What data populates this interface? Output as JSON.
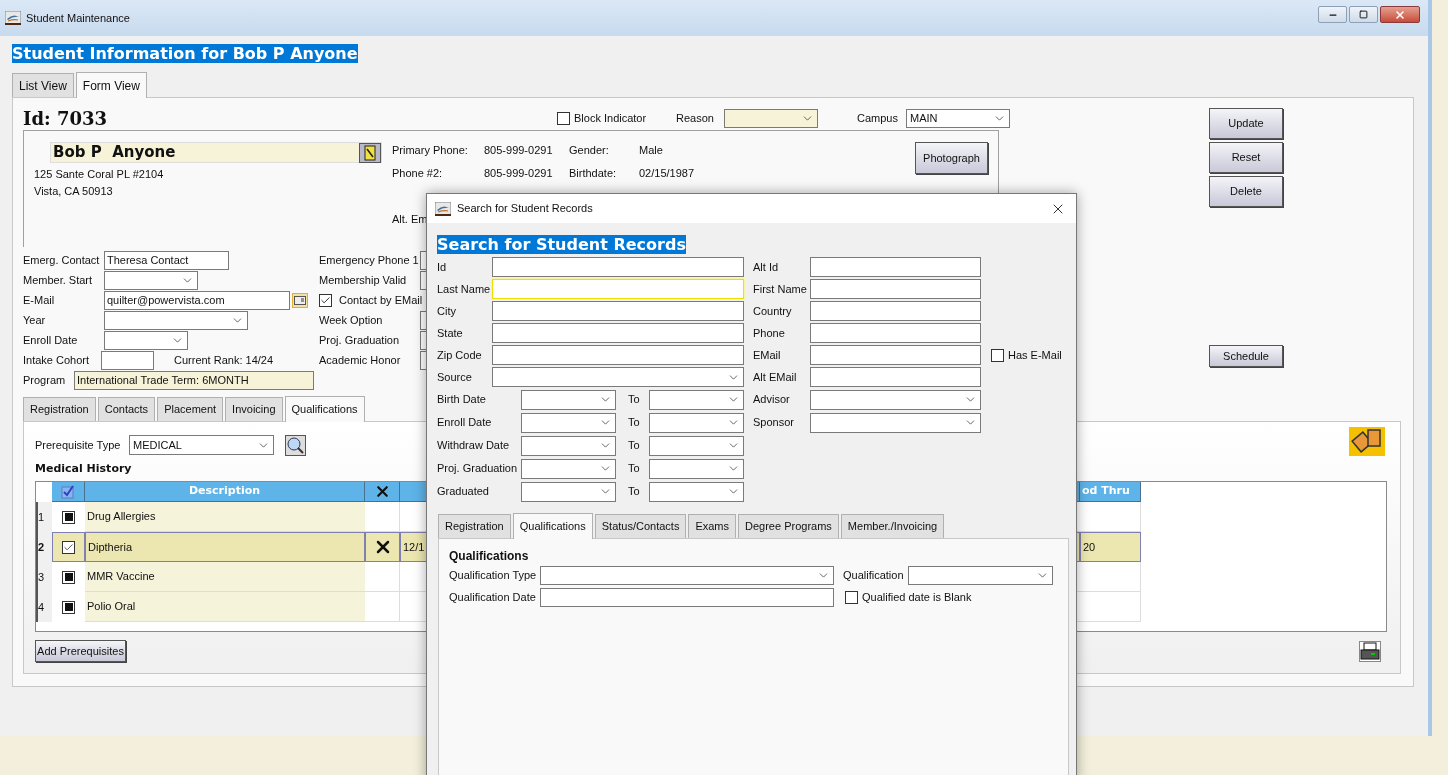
{
  "main_window": {
    "title": "Student Maintenance",
    "heading": "Student Information for Bob P Anyone",
    "view_tabs": [
      {
        "label": "List View",
        "selected": false
      },
      {
        "label": "Form View",
        "selected": true
      }
    ],
    "id_label": "Id: 7033",
    "block_indicator": {
      "label": "Block Indicator",
      "checked": false
    },
    "reason": {
      "label": "Reason"
    },
    "campus": {
      "label": "Campus",
      "value": "MAIN"
    },
    "student_card": {
      "name": "Bob P  Anyone",
      "address_lines": [
        "125 Sante Coral PL #2104",
        "Vista, CA 50913"
      ],
      "contact_rows": [
        {
          "label": "Primary Phone:",
          "value": "805-999-0291"
        },
        {
          "label": "Phone #2:",
          "value": "805-999-0291"
        },
        {},
        {
          "label": "Alt. Em"
        }
      ],
      "personal_rows": [
        {
          "label": "Gender:",
          "value": "Male"
        },
        {
          "label": "Birthdate:",
          "value": "02/15/1987"
        }
      ],
      "buttons": [
        "Photograph"
      ]
    },
    "action_buttons": [
      "Update",
      "Reset",
      "Delete"
    ],
    "schedule_button": "Schedule",
    "left_fields": [
      {
        "kind": "text",
        "label": "Emerg. Contact",
        "value": "Theresa Contact"
      },
      {
        "kind": "dropdown",
        "label": "Member. Start"
      },
      {
        "kind": "email",
        "label": "E-Mail",
        "value": "quilter@powervista.com"
      },
      {
        "kind": "dropdown",
        "label": "Year"
      },
      {
        "kind": "dropdown",
        "label": "Enroll Date"
      },
      {
        "kind": "cohort",
        "label": "Intake Cohort",
        "note": "Current Rank: 14/24"
      },
      {
        "kind": "program",
        "label": "Program",
        "value": "International Trade Term: 6MONTH"
      }
    ],
    "right_fields": [
      {
        "kind": "text",
        "label": "Emergency Phone 1"
      },
      {
        "kind": "text",
        "label": "Membership Valid"
      },
      {
        "kind": "checkbox",
        "label": "Contact by EMail",
        "checked": true
      },
      {
        "kind": "text",
        "label": "Week Option"
      },
      {
        "kind": "text",
        "label": "Proj. Graduation"
      },
      {
        "kind": "text",
        "label": "Academic Honor"
      }
    ],
    "sub_tabs": [
      {
        "label": "Registration",
        "selected": false
      },
      {
        "label": "Contacts",
        "selected": false
      },
      {
        "label": "Placement",
        "selected": false
      },
      {
        "label": "Invoicing",
        "selected": false
      },
      {
        "label": "Qualifications",
        "selected": true
      }
    ],
    "prerequisite_type": {
      "label": "Prerequisite Type",
      "value": "MEDICAL"
    },
    "section_title": "Medical History",
    "table": {
      "columns": [
        {
          "kind": "check"
        },
        {
          "kind": "text",
          "label": "Description"
        },
        {
          "kind": "icon"
        },
        {
          "kind": "text"
        },
        {
          "kind": "text",
          "label": "od Thru"
        }
      ],
      "rows": [
        {
          "number": "1",
          "checked": false,
          "description": "Drug Allergies",
          "selected": false
        },
        {
          "number": "2",
          "checked": true,
          "description": "Diptheria",
          "selected": true,
          "cells": [
            "12/1",
            "20"
          ]
        },
        {
          "number": "3",
          "checked": false,
          "description": "MMR Vaccine",
          "selected": false
        },
        {
          "number": "4",
          "checked": false,
          "description": "Polio Oral",
          "selected": false
        }
      ]
    },
    "add_button": "Add Prerequisites"
  },
  "search_dialog": {
    "title": "Search for Student Records",
    "heading": "Search for Student Records",
    "left_fields": [
      {
        "kind": "text",
        "label": "Id",
        "focused": false
      },
      {
        "kind": "text",
        "label": "Last Name",
        "focused": true
      },
      {
        "kind": "text",
        "label": "City",
        "focused": false
      },
      {
        "kind": "text",
        "label": "State",
        "focused": false
      },
      {
        "kind": "text",
        "label": "Zip Code",
        "focused": false
      },
      {
        "kind": "dropdown",
        "label": "Source",
        "focused": false
      }
    ],
    "right_fields": [
      {
        "kind": "text",
        "label": "Alt Id"
      },
      {
        "kind": "text",
        "label": "First Name"
      },
      {
        "kind": "text",
        "label": "Country"
      },
      {
        "kind": "text",
        "label": "Phone"
      },
      {
        "kind": "text",
        "label": "EMail"
      },
      {
        "kind": "text",
        "label": "Alt EMail"
      },
      {
        "kind": "dropdown",
        "label": "Advisor"
      },
      {
        "kind": "dropdown",
        "label": "Sponsor"
      }
    ],
    "has_email": {
      "label": "Has E-Mail",
      "checked": false
    },
    "date_ranges": [
      {
        "label": "Birth Date",
        "to": "To"
      },
      {
        "label": "Enroll Date",
        "to": "To"
      },
      {
        "label": "Withdraw Date",
        "to": "To"
      },
      {
        "label": "Proj. Graduation",
        "to": "To"
      },
      {
        "label": "Graduated",
        "to": "To"
      }
    ],
    "tabs": [
      {
        "label": "Registration",
        "selected": false
      },
      {
        "label": "Qualifications",
        "selected": true
      },
      {
        "label": "Status/Contacts",
        "selected": false
      },
      {
        "label": "Exams",
        "selected": false
      },
      {
        "label": "Degree Programs",
        "selected": false
      },
      {
        "label": "Member./Invoicing",
        "selected": false
      }
    ],
    "qualifications": {
      "title": "Qualifications",
      "type_label": "Qualification Type",
      "qualification_label": "Qualification",
      "date_label": "Qualification Date",
      "blank_date": {
        "label": "Qualified date is Blank",
        "checked": false
      }
    }
  }
}
